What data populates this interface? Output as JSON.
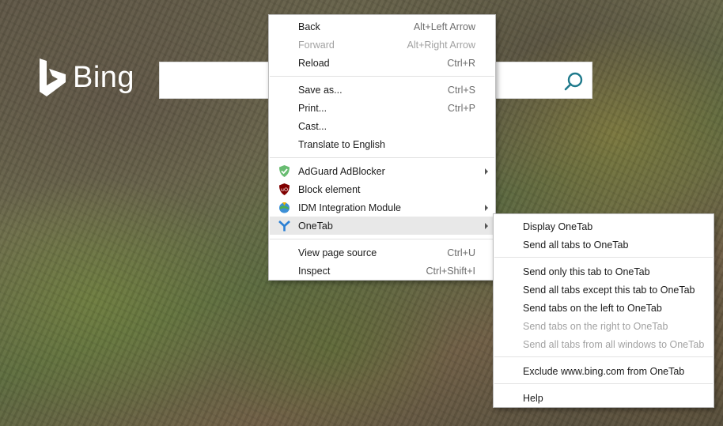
{
  "bing": {
    "brand": "Bing",
    "search_value": ""
  },
  "context_menu": {
    "items": [
      {
        "label": "Back",
        "shortcut": "Alt+Left Arrow"
      },
      {
        "label": "Forward",
        "shortcut": "Alt+Right Arrow",
        "disabled": true
      },
      {
        "label": "Reload",
        "shortcut": "Ctrl+R"
      },
      {
        "label": "Save as...",
        "shortcut": "Ctrl+S"
      },
      {
        "label": "Print...",
        "shortcut": "Ctrl+P"
      },
      {
        "label": "Cast..."
      },
      {
        "label": "Translate to English"
      },
      {
        "label": "AdGuard AdBlocker",
        "icon": "adguard-icon"
      },
      {
        "label": "Block element",
        "icon": "ublock-icon"
      },
      {
        "label": "IDM Integration Module",
        "icon": "idm-icon"
      },
      {
        "label": "OneTab",
        "icon": "onetab-icon"
      },
      {
        "label": "View page source",
        "shortcut": "Ctrl+U"
      },
      {
        "label": "Inspect",
        "shortcut": "Ctrl+Shift+I"
      }
    ]
  },
  "onetab_submenu": {
    "items": [
      {
        "label": "Display OneTab"
      },
      {
        "label": "Send all tabs to OneTab"
      },
      {
        "label": "Send only this tab to OneTab"
      },
      {
        "label": "Send all tabs except this tab to OneTab"
      },
      {
        "label": "Send tabs on the left to OneTab"
      },
      {
        "label": "Send tabs on the right to OneTab",
        "disabled": true
      },
      {
        "label": "Send all tabs from all windows to OneTab",
        "disabled": true
      },
      {
        "label": "Exclude www.bing.com from OneTab"
      },
      {
        "label": "Help"
      }
    ]
  },
  "colors": {
    "adguard": "#68bc71",
    "ublock": "#800000",
    "onetab": "#2a7fd4",
    "search_icon": "#1f7a8c"
  }
}
